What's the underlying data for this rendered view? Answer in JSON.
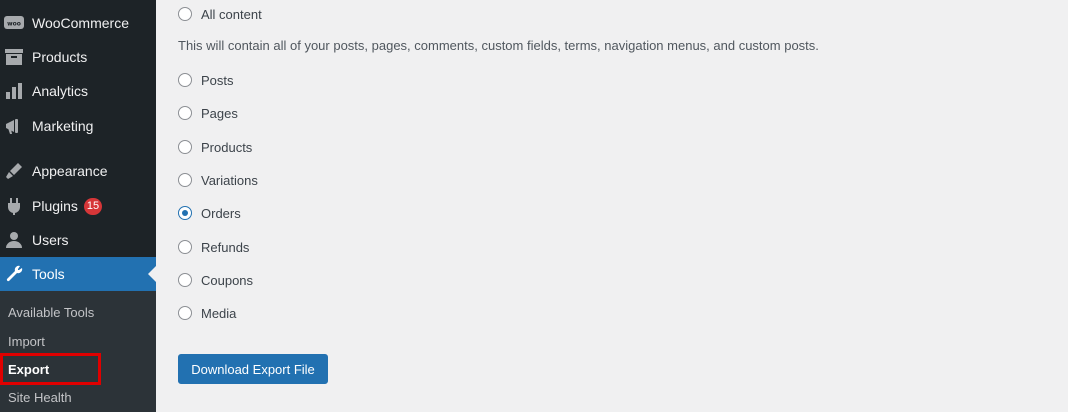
{
  "sidebar": {
    "items": [
      {
        "label": "WooCommerce",
        "icon": "woocommerce-icon"
      },
      {
        "label": "Products",
        "icon": "products-icon"
      },
      {
        "label": "Analytics",
        "icon": "analytics-icon"
      },
      {
        "label": "Marketing",
        "icon": "marketing-icon"
      },
      {
        "label": "Appearance",
        "icon": "appearance-icon"
      },
      {
        "label": "Plugins",
        "icon": "plugins-icon",
        "badge": "15"
      },
      {
        "label": "Users",
        "icon": "users-icon"
      },
      {
        "label": "Tools",
        "icon": "tools-icon",
        "active": true
      }
    ],
    "submenu": [
      {
        "label": "Available Tools"
      },
      {
        "label": "Import"
      },
      {
        "label": "Export",
        "current": true
      },
      {
        "label": "Site Health"
      }
    ]
  },
  "export": {
    "options": [
      {
        "label": "All content",
        "checked": false
      },
      {
        "label": "Posts",
        "checked": false
      },
      {
        "label": "Pages",
        "checked": false
      },
      {
        "label": "Products",
        "checked": false
      },
      {
        "label": "Variations",
        "checked": false
      },
      {
        "label": "Orders",
        "checked": true
      },
      {
        "label": "Refunds",
        "checked": false
      },
      {
        "label": "Coupons",
        "checked": false
      },
      {
        "label": "Media",
        "checked": false
      }
    ],
    "all_content_description": "This will contain all of your posts, pages, comments, custom fields, terms, navigation menus, and custom posts.",
    "download_button": "Download Export File"
  },
  "colors": {
    "sidebar_bg": "#1d2327",
    "accent": "#2271b1",
    "badge": "#d63638",
    "highlight": "#e00000"
  }
}
